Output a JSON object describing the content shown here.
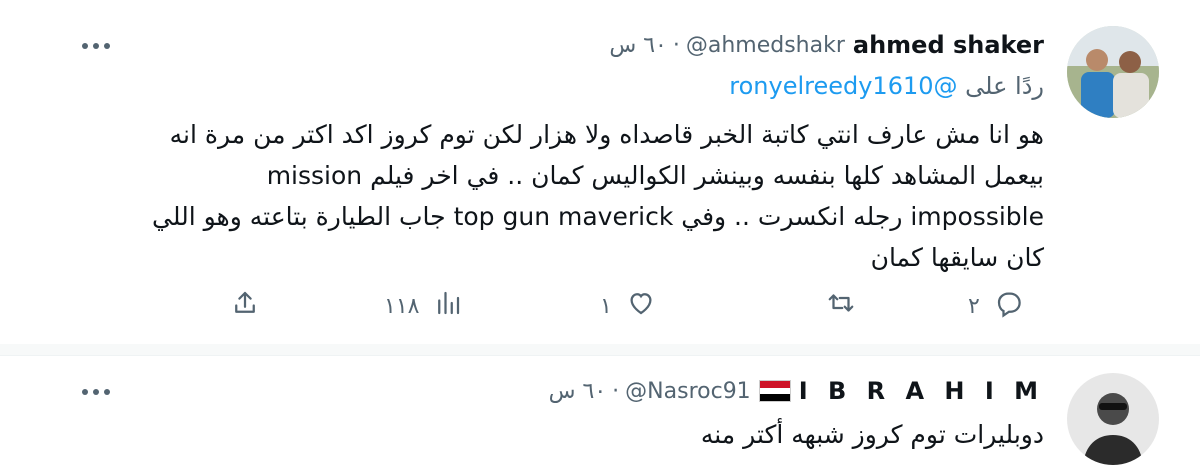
{
  "tweets": [
    {
      "author_name": "ahmed shaker",
      "handle": "@ahmedshakr",
      "separator": "·",
      "time": "٦٠ س",
      "reply_prefix": "ردًا على",
      "reply_mention": "@ronyelreedy1610",
      "text_lines": [
        "هو انا مش عارف انتي كاتبة الخبر قاصداه ولا هزار لكن توم كروز اكد اكتر من مرة انه",
        "بيعمل المشاهد كلها بنفسه وبينشر الكواليس كمان .. في اخر فيلم mission",
        "impossible رجله انكسرت .. وفي top gun maverick جاب الطيارة بتاعته وهو اللي",
        "كان سايقها كمان"
      ],
      "actions": {
        "reply_count": "٢",
        "retweet_count": "",
        "like_count": "١",
        "views_count": "١١٨"
      },
      "icons": [
        "avatar",
        "more-icon",
        "reply-icon",
        "retweet-icon",
        "like-icon",
        "views-icon",
        "share-icon"
      ]
    },
    {
      "author_name": "I B R A H I M",
      "handle": "@Nasroc91",
      "separator": "·",
      "time": "٦٠ س",
      "flag": "egypt-flag-icon",
      "text_lines": [
        "دوبليرات توم كروز شبهه أكتر منه"
      ]
    }
  ],
  "colors": {
    "accent": "#1d9bf0",
    "secondary_text": "#536471",
    "primary_text": "#0f1419"
  }
}
